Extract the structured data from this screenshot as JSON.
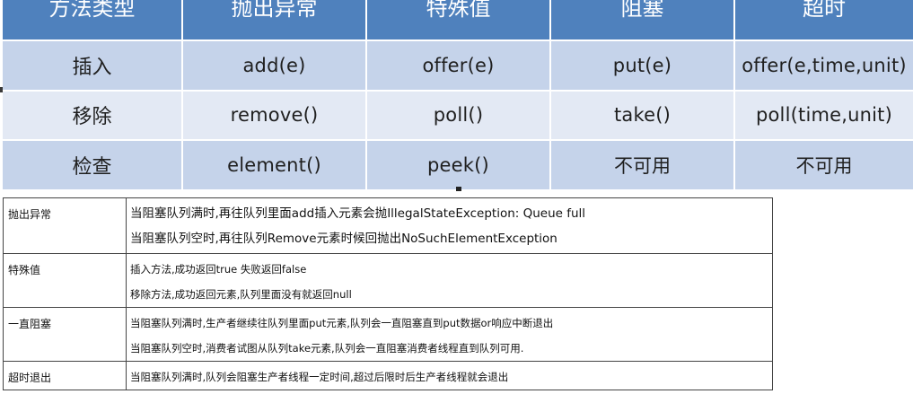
{
  "methods_table": {
    "headers": [
      "方法类型",
      "抛出异常",
      "特殊值",
      "阻塞",
      "超时"
    ],
    "rows": [
      {
        "label": "插入",
        "throws": "add(e)",
        "special": "offer(e)",
        "blocks": "put(e)",
        "timeout": "offer(e,time,unit)"
      },
      {
        "label": "移除",
        "throws": "remove()",
        "special": "poll()",
        "blocks": "take()",
        "timeout": "poll(time,unit)"
      },
      {
        "label": "检查",
        "throws": "element()",
        "special": "peek()",
        "blocks": "不可用",
        "timeout": "不可用"
      }
    ],
    "colors": {
      "header_bg": "#4f81bd",
      "row_dark": "#c5d3ea",
      "row_light": "#e3e9f4"
    }
  },
  "desc_table": {
    "rows": [
      {
        "type": "抛出异常",
        "lines": [
          "当阻塞队列满时,再往队列里面add插入元素会抛IllegalStateException: Queue full",
          "当阻塞队列空时,再往队列Remove元素时候回抛出NoSuchElementException"
        ]
      },
      {
        "type": "特殊值",
        "lines": [
          "插入方法,成功返回true 失败返回false",
          "移除方法,成功返回元素,队列里面没有就返回null"
        ]
      },
      {
        "type": "一直阻塞",
        "lines": [
          "当阻塞队列满时,生产者继续往队列里面put元素,队列会一直阻塞直到put数据or响应中断退出",
          "当阻塞队列空时,消费者试图从队列take元素,队列会一直阻塞消费者线程直到队列可用."
        ]
      },
      {
        "type": "超时退出",
        "lines": [
          "当阻塞队列满时,队列会阻塞生产者线程一定时间,超过后限时后生产者线程就会退出"
        ]
      }
    ]
  }
}
